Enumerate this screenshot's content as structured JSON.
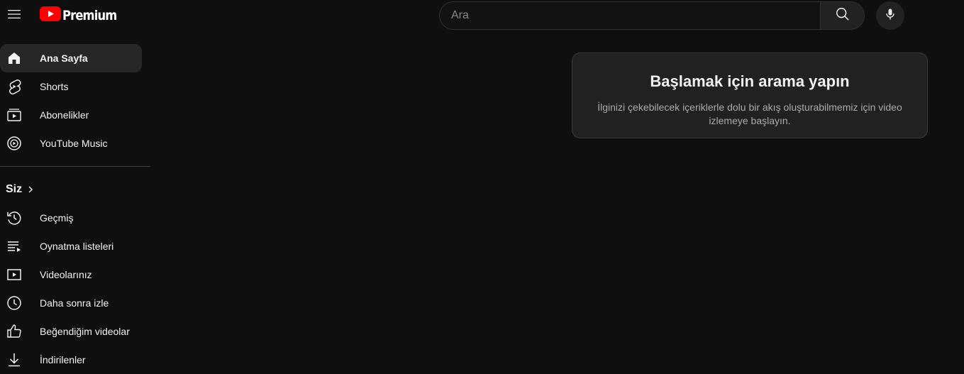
{
  "header": {
    "brand_label": "Premium",
    "search_placeholder": "Ara",
    "icons": {
      "menu": "hamburger-menu-icon",
      "logo": "youtube-logo-icon",
      "search": "search-icon",
      "mic": "microphone-icon"
    }
  },
  "sidebar": {
    "main_items": [
      {
        "label": "Ana Sayfa",
        "icon": "home-icon",
        "active": true
      },
      {
        "label": "Shorts",
        "icon": "shorts-icon"
      },
      {
        "label": "Abonelikler",
        "icon": "subscriptions-icon"
      },
      {
        "label": "YouTube Music",
        "icon": "youtube-music-icon"
      }
    ],
    "you_section_title": "Siz",
    "you_items": [
      {
        "label": "Geçmiş",
        "icon": "history-icon"
      },
      {
        "label": "Oynatma listeleri",
        "icon": "playlists-icon"
      },
      {
        "label": "Videolarınız",
        "icon": "your-videos-icon"
      },
      {
        "label": "Daha sonra izle",
        "icon": "watch-later-icon"
      },
      {
        "label": "Beğendiğim videolar",
        "icon": "liked-videos-icon"
      },
      {
        "label": "İndirilenler",
        "icon": "downloads-icon"
      }
    ]
  },
  "main": {
    "prompt_title": "Başlamak için arama yapın",
    "prompt_description": "İlginizi çekebilecek içeriklerle dolu bir akış oluşturabilmemiz için video izlemeye başlayın."
  },
  "colors": {
    "background": "#0f0f0f",
    "brand_red": "#ff0000",
    "active_item_bg": "#272727",
    "card_bg": "#212121"
  }
}
